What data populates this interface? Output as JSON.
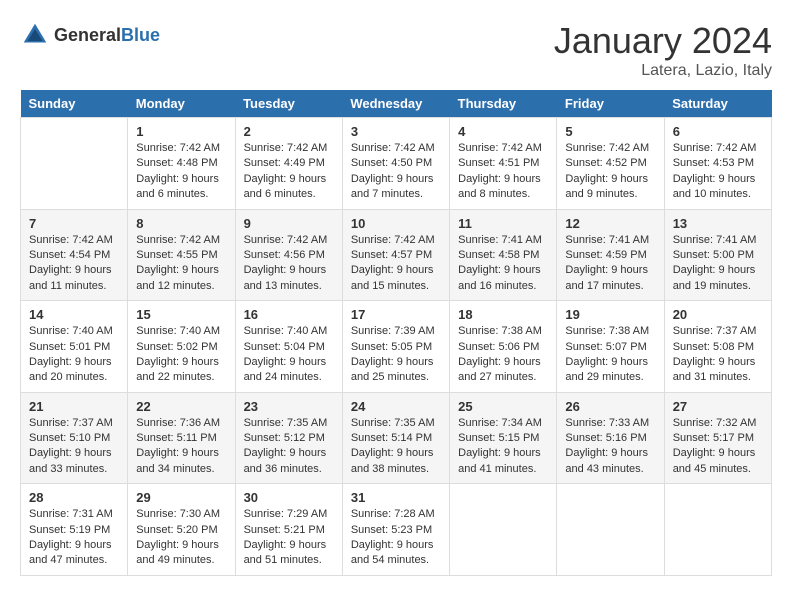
{
  "header": {
    "logo_general": "General",
    "logo_blue": "Blue",
    "month": "January 2024",
    "location": "Latera, Lazio, Italy"
  },
  "columns": [
    "Sunday",
    "Monday",
    "Tuesday",
    "Wednesday",
    "Thursday",
    "Friday",
    "Saturday"
  ],
  "weeks": [
    [
      {
        "day": "",
        "content": ""
      },
      {
        "day": "1",
        "content": "Sunrise: 7:42 AM\nSunset: 4:48 PM\nDaylight: 9 hours\nand 6 minutes."
      },
      {
        "day": "2",
        "content": "Sunrise: 7:42 AM\nSunset: 4:49 PM\nDaylight: 9 hours\nand 6 minutes."
      },
      {
        "day": "3",
        "content": "Sunrise: 7:42 AM\nSunset: 4:50 PM\nDaylight: 9 hours\nand 7 minutes."
      },
      {
        "day": "4",
        "content": "Sunrise: 7:42 AM\nSunset: 4:51 PM\nDaylight: 9 hours\nand 8 minutes."
      },
      {
        "day": "5",
        "content": "Sunrise: 7:42 AM\nSunset: 4:52 PM\nDaylight: 9 hours\nand 9 minutes."
      },
      {
        "day": "6",
        "content": "Sunrise: 7:42 AM\nSunset: 4:53 PM\nDaylight: 9 hours\nand 10 minutes."
      }
    ],
    [
      {
        "day": "7",
        "content": "Sunrise: 7:42 AM\nSunset: 4:54 PM\nDaylight: 9 hours\nand 11 minutes."
      },
      {
        "day": "8",
        "content": "Sunrise: 7:42 AM\nSunset: 4:55 PM\nDaylight: 9 hours\nand 12 minutes."
      },
      {
        "day": "9",
        "content": "Sunrise: 7:42 AM\nSunset: 4:56 PM\nDaylight: 9 hours\nand 13 minutes."
      },
      {
        "day": "10",
        "content": "Sunrise: 7:42 AM\nSunset: 4:57 PM\nDaylight: 9 hours\nand 15 minutes."
      },
      {
        "day": "11",
        "content": "Sunrise: 7:41 AM\nSunset: 4:58 PM\nDaylight: 9 hours\nand 16 minutes."
      },
      {
        "day": "12",
        "content": "Sunrise: 7:41 AM\nSunset: 4:59 PM\nDaylight: 9 hours\nand 17 minutes."
      },
      {
        "day": "13",
        "content": "Sunrise: 7:41 AM\nSunset: 5:00 PM\nDaylight: 9 hours\nand 19 minutes."
      }
    ],
    [
      {
        "day": "14",
        "content": "Sunrise: 7:40 AM\nSunset: 5:01 PM\nDaylight: 9 hours\nand 20 minutes."
      },
      {
        "day": "15",
        "content": "Sunrise: 7:40 AM\nSunset: 5:02 PM\nDaylight: 9 hours\nand 22 minutes."
      },
      {
        "day": "16",
        "content": "Sunrise: 7:40 AM\nSunset: 5:04 PM\nDaylight: 9 hours\nand 24 minutes."
      },
      {
        "day": "17",
        "content": "Sunrise: 7:39 AM\nSunset: 5:05 PM\nDaylight: 9 hours\nand 25 minutes."
      },
      {
        "day": "18",
        "content": "Sunrise: 7:38 AM\nSunset: 5:06 PM\nDaylight: 9 hours\nand 27 minutes."
      },
      {
        "day": "19",
        "content": "Sunrise: 7:38 AM\nSunset: 5:07 PM\nDaylight: 9 hours\nand 29 minutes."
      },
      {
        "day": "20",
        "content": "Sunrise: 7:37 AM\nSunset: 5:08 PM\nDaylight: 9 hours\nand 31 minutes."
      }
    ],
    [
      {
        "day": "21",
        "content": "Sunrise: 7:37 AM\nSunset: 5:10 PM\nDaylight: 9 hours\nand 33 minutes."
      },
      {
        "day": "22",
        "content": "Sunrise: 7:36 AM\nSunset: 5:11 PM\nDaylight: 9 hours\nand 34 minutes."
      },
      {
        "day": "23",
        "content": "Sunrise: 7:35 AM\nSunset: 5:12 PM\nDaylight: 9 hours\nand 36 minutes."
      },
      {
        "day": "24",
        "content": "Sunrise: 7:35 AM\nSunset: 5:14 PM\nDaylight: 9 hours\nand 38 minutes."
      },
      {
        "day": "25",
        "content": "Sunrise: 7:34 AM\nSunset: 5:15 PM\nDaylight: 9 hours\nand 41 minutes."
      },
      {
        "day": "26",
        "content": "Sunrise: 7:33 AM\nSunset: 5:16 PM\nDaylight: 9 hours\nand 43 minutes."
      },
      {
        "day": "27",
        "content": "Sunrise: 7:32 AM\nSunset: 5:17 PM\nDaylight: 9 hours\nand 45 minutes."
      }
    ],
    [
      {
        "day": "28",
        "content": "Sunrise: 7:31 AM\nSunset: 5:19 PM\nDaylight: 9 hours\nand 47 minutes."
      },
      {
        "day": "29",
        "content": "Sunrise: 7:30 AM\nSunset: 5:20 PM\nDaylight: 9 hours\nand 49 minutes."
      },
      {
        "day": "30",
        "content": "Sunrise: 7:29 AM\nSunset: 5:21 PM\nDaylight: 9 hours\nand 51 minutes."
      },
      {
        "day": "31",
        "content": "Sunrise: 7:28 AM\nSunset: 5:23 PM\nDaylight: 9 hours\nand 54 minutes."
      },
      {
        "day": "",
        "content": ""
      },
      {
        "day": "",
        "content": ""
      },
      {
        "day": "",
        "content": ""
      }
    ]
  ]
}
